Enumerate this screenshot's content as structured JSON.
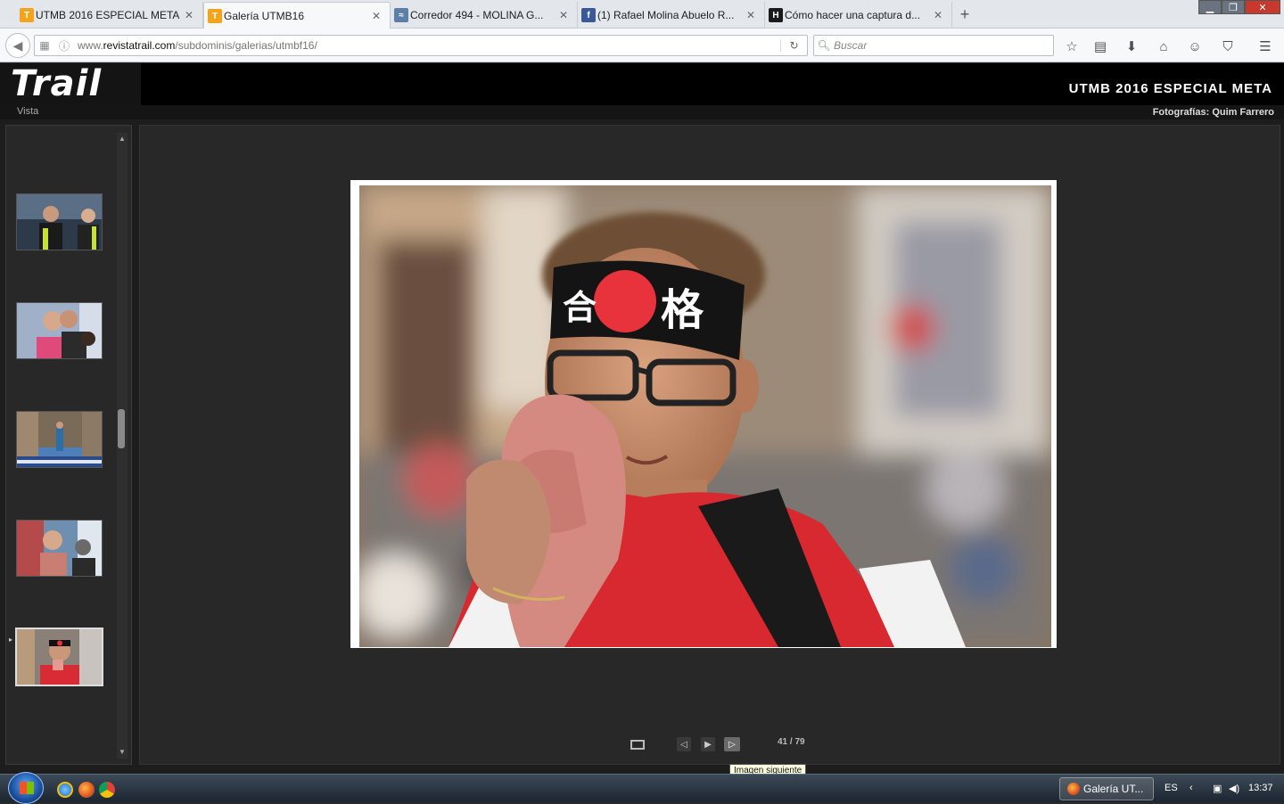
{
  "browser": {
    "tabs": [
      {
        "label": "UTMB 2016 ESPECIAL META",
        "favicon": "trail-favicon",
        "favicon_color": "#f5a31a",
        "active": false
      },
      {
        "label": "Galería UTMB16",
        "favicon": "trail-favicon",
        "favicon_color": "#f5a31a",
        "active": true
      },
      {
        "label": "Corredor 494 - MOLINA G...",
        "favicon": "web-favicon",
        "favicon_color": "#5b7fa6",
        "active": false
      },
      {
        "label": "(1) Rafael Molina Abuelo R...",
        "favicon": "facebook-favicon",
        "favicon_color": "#3b5998",
        "active": false
      },
      {
        "label": "Cómo hacer una captura d...",
        "favicon": "h-favicon",
        "favicon_color": "#1a1a1a",
        "active": false
      }
    ],
    "favicon_glyphs": {
      "trail": "T",
      "facebook": "f",
      "h": "H",
      "web": "≈"
    },
    "new_tab": "+",
    "window_controls": {
      "minimize": "▁",
      "restore": "❐",
      "close": "✕"
    },
    "url_prefix": "www.",
    "url_domain": "revistatrail.com",
    "url_path": "/subdominis/galerias/utmbf16/",
    "search_placeholder": "Buscar"
  },
  "site": {
    "logo": "Trail",
    "gallery_title": "UTMB 2016 ESPECIAL META",
    "view_label": "Vista",
    "credits": "Fotografías: Quim Farrero"
  },
  "gallery": {
    "counter": "41 / 79",
    "tooltip": "Imagen siguiente",
    "selected_index": 4,
    "thumbnails": [
      {
        "name": "thumb-two-runners"
      },
      {
        "name": "thumb-family-kiss"
      },
      {
        "name": "thumb-finish-line"
      },
      {
        "name": "thumb-woman-hug"
      },
      {
        "name": "thumb-headband-runner"
      }
    ],
    "headband_kanji_left": "合",
    "headband_kanji_right": "格"
  },
  "taskbar": {
    "task_label": "Galería UT...",
    "language": "ES",
    "time": "13:37"
  },
  "colors": {
    "site_header": "#000000",
    "gallery_bg": "#1d1d1d",
    "stage_bg": "#282828",
    "accent_red": "#e8323c"
  }
}
